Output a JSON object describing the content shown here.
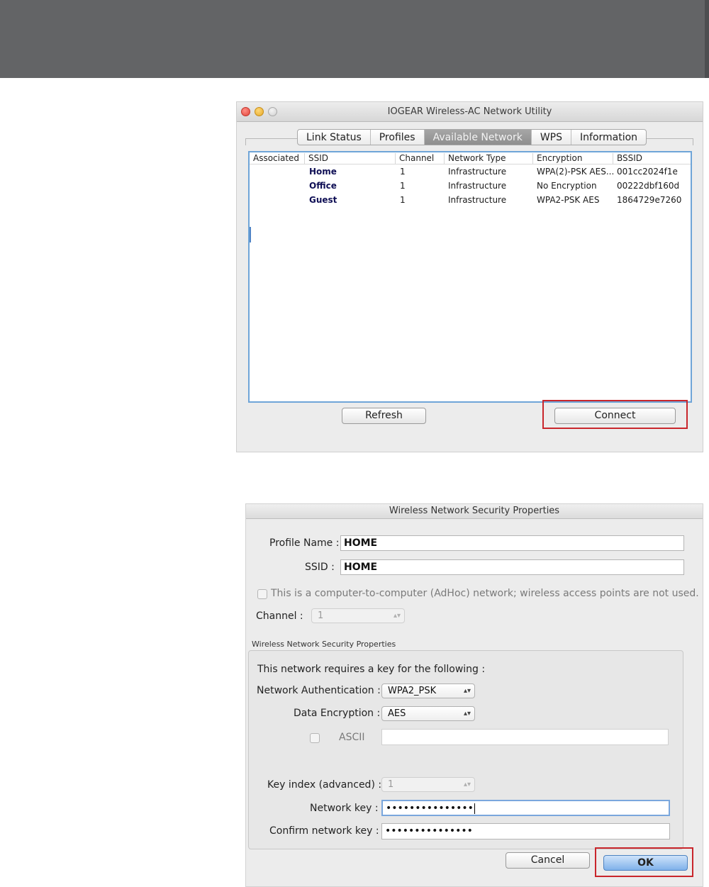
{
  "window1": {
    "title": "IOGEAR Wireless-AC Network Utility",
    "tabs": [
      {
        "label": "Link Status",
        "active": false
      },
      {
        "label": "Profiles",
        "active": false
      },
      {
        "label": "Available Network",
        "active": true
      },
      {
        "label": "WPS",
        "active": false
      },
      {
        "label": "Information",
        "active": false
      }
    ],
    "columns": [
      "Associated",
      "SSID",
      "Channel",
      "Network Type",
      "Encryption",
      "BSSID"
    ],
    "rows": [
      {
        "associated": "",
        "ssid": "Home",
        "channel": "1",
        "network_type": "Infrastructure",
        "encryption": "WPA(2)-PSK AES...",
        "bssid": "001cc2024f1e"
      },
      {
        "associated": "",
        "ssid": "Office",
        "channel": "1",
        "network_type": "Infrastructure",
        "encryption": "No Encryption",
        "bssid": "00222dbf160d"
      },
      {
        "associated": "",
        "ssid": "Guest",
        "channel": "1",
        "network_type": "Infrastructure",
        "encryption": "WPA2-PSK AES",
        "bssid": "1864729e7260"
      }
    ],
    "refresh_label": "Refresh",
    "connect_label": "Connect"
  },
  "window2": {
    "title": "Wireless Network Security Properties",
    "profile_name_label": "Profile Name :",
    "profile_name_value": "HOME",
    "ssid_label": "SSID :",
    "ssid_value": "HOME",
    "adhoc_label": "This is a computer-to-computer (AdHoc) network; wireless access points are not used.",
    "channel_label": "Channel :",
    "channel_value": "1",
    "group_title": "Wireless Network Security Properties",
    "requires_key_label": "This network requires a key for the following :",
    "auth_label": "Network Authentication :",
    "auth_value": "WPA2_PSK",
    "encryption_label": "Data Encryption :",
    "encryption_value": "AES",
    "ascii_label": "ASCII",
    "key_index_label": "Key index (advanced) :",
    "key_index_value": "1",
    "network_key_label": "Network key :",
    "network_key_value": "•••••••••••••••",
    "confirm_key_label": "Confirm network key :",
    "confirm_key_value": "•••••••••••••••",
    "cancel_label": "Cancel",
    "ok_label": "OK"
  },
  "colors": {
    "highlight_box": "#c9262c",
    "header_band": "#636466",
    "table_border": "#6fa5d8"
  }
}
